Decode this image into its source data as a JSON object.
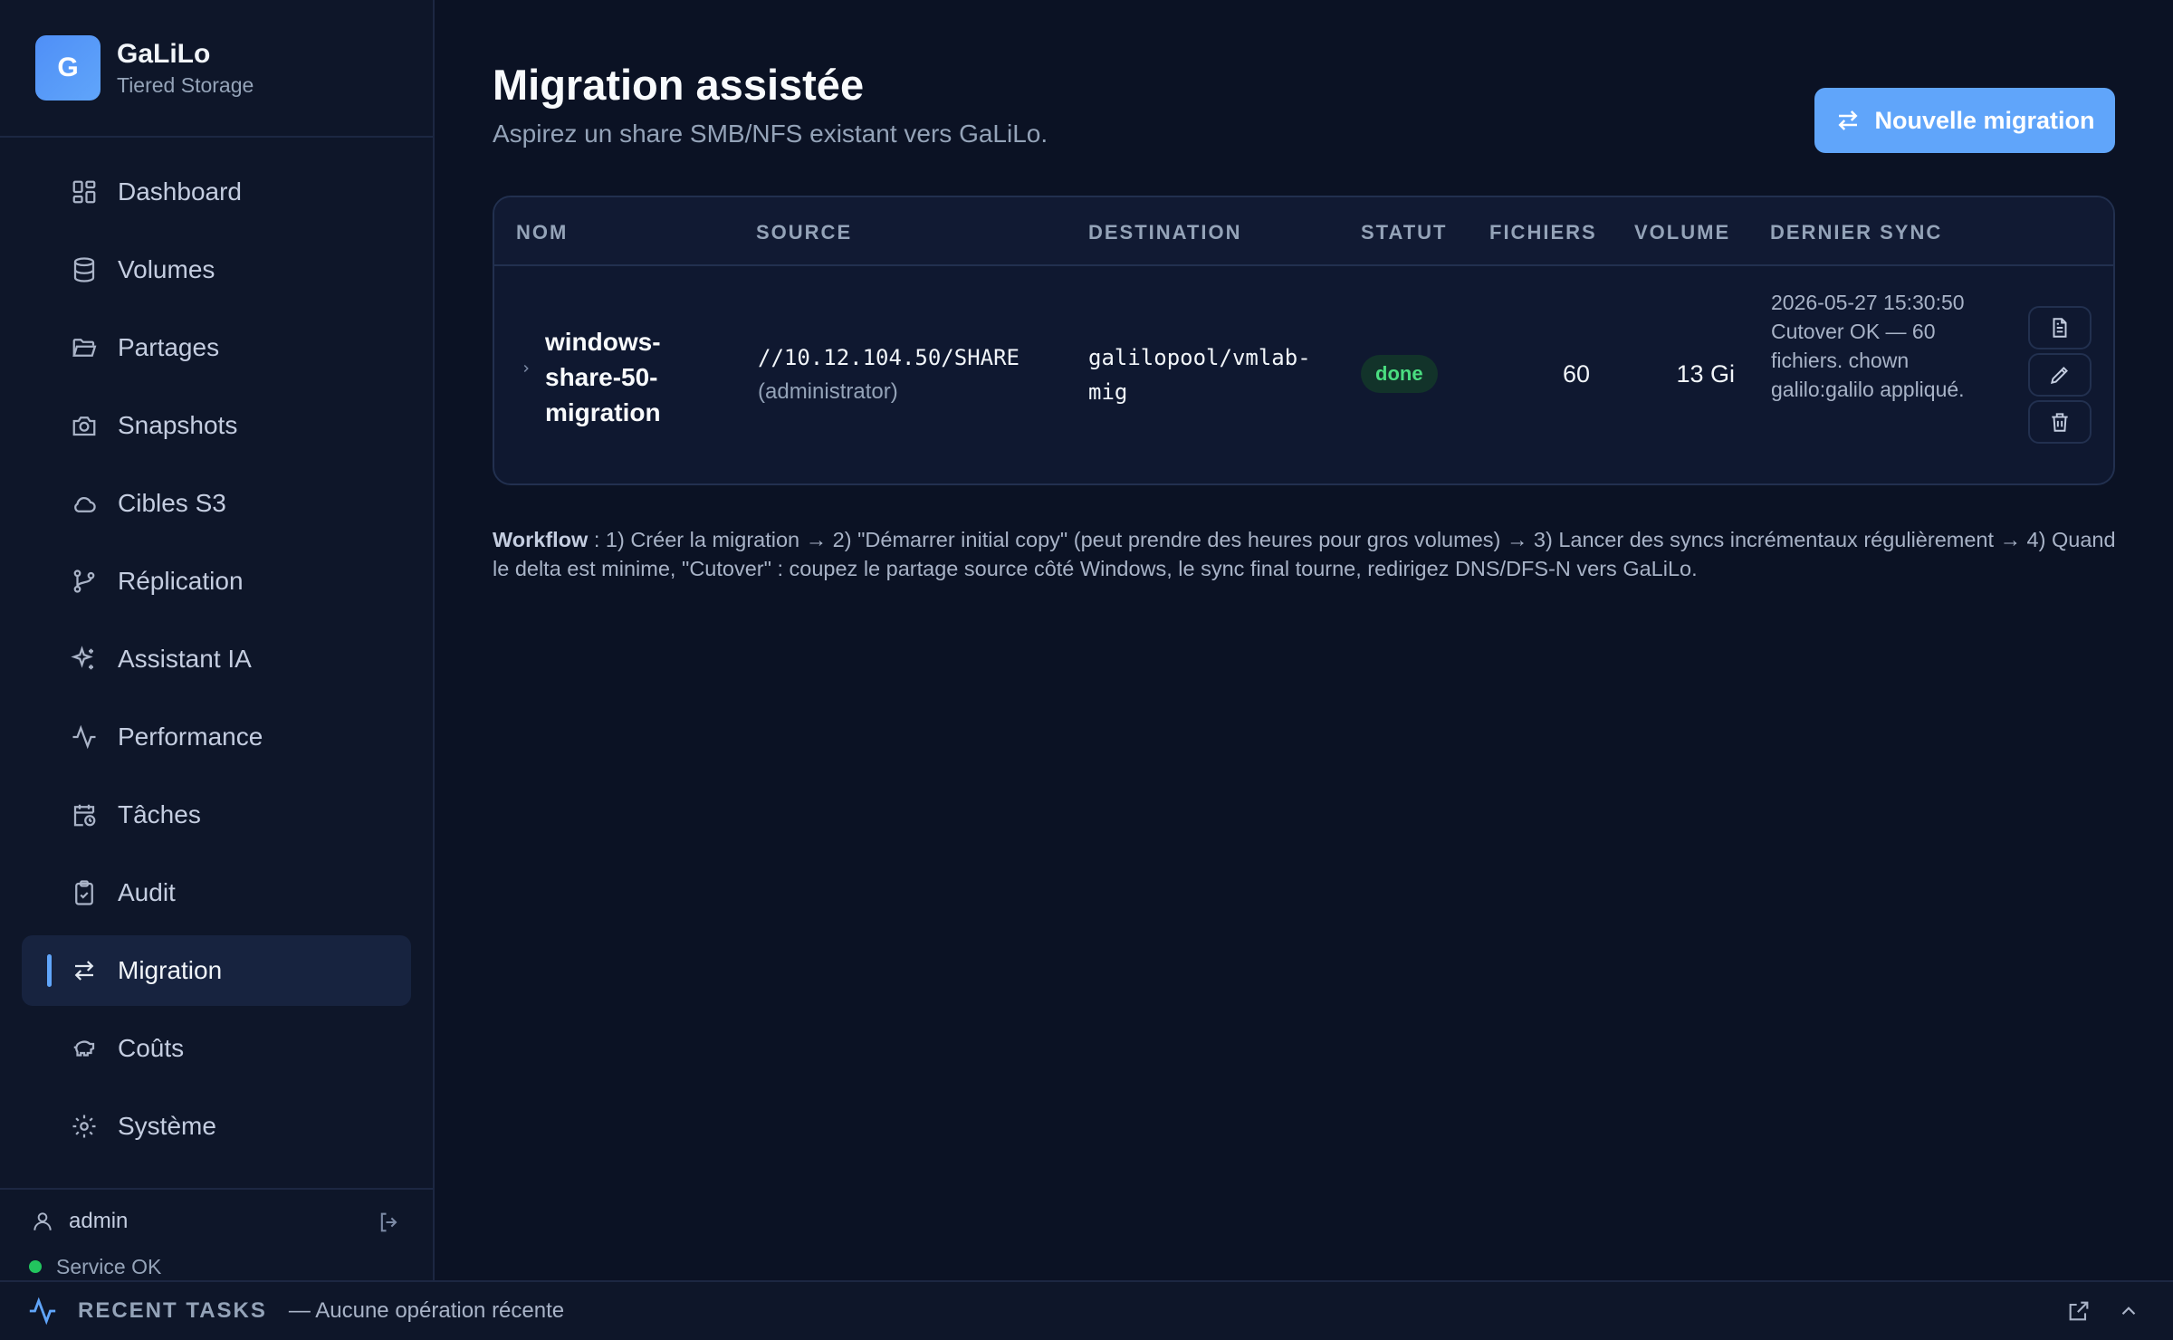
{
  "brand": {
    "logo_letter": "G",
    "name": "GaLiLo",
    "subtitle": "Tiered Storage"
  },
  "sidebar": {
    "items": [
      {
        "label": "Dashboard",
        "icon": "dashboard-icon"
      },
      {
        "label": "Volumes",
        "icon": "database-icon"
      },
      {
        "label": "Partages",
        "icon": "folder-icon"
      },
      {
        "label": "Snapshots",
        "icon": "camera-icon"
      },
      {
        "label": "Cibles S3",
        "icon": "cloud-icon"
      },
      {
        "label": "Réplication",
        "icon": "git-branch-icon"
      },
      {
        "label": "Assistant IA",
        "icon": "sparkles-icon"
      },
      {
        "label": "Performance",
        "icon": "activity-icon"
      },
      {
        "label": "Tâches",
        "icon": "calendar-clock-icon"
      },
      {
        "label": "Audit",
        "icon": "clipboard-check-icon"
      },
      {
        "label": "Migration",
        "icon": "arrows-swap-icon",
        "active": true
      },
      {
        "label": "Coûts",
        "icon": "piggy-bank-icon"
      },
      {
        "label": "Système",
        "icon": "gear-icon"
      }
    ],
    "footer": {
      "user": "admin",
      "service_status": "Service OK"
    }
  },
  "page": {
    "title": "Migration assistée",
    "subtitle": "Aspirez un share SMB/NFS existant vers GaLiLo.",
    "new_button": "Nouvelle migration"
  },
  "table": {
    "headers": [
      "NOM",
      "SOURCE",
      "DESTINATION",
      "STATUT",
      "FICHIERS",
      "VOLUME",
      "DERNIER SYNC"
    ],
    "rows": [
      {
        "name": "windows-share-50-migration",
        "source": "//10.12.104.50/SHARE",
        "source_user": "(administrator)",
        "destination": "galilopool/vmlab-mig",
        "status": "done",
        "files": "60",
        "volume": "13 Gi",
        "last_sync": "2026-05-27 15:30:50 Cutover OK — 60 fichiers. chown galilo:galilo appliqué."
      }
    ]
  },
  "workflow": {
    "label": "Workflow",
    "text": " : 1) Créer la migration → 2) \"Démarrer initial copy\" (peut prendre des heures pour gros volumes) → 3) Lancer des syncs incrémentaux régulièrement → 4) Quand le delta est minime, \"Cutover\" : coupez le partage source côté Windows, le sync final tourne, redirigez DNS/DFS-N vers GaLiLo."
  },
  "recent_tasks": {
    "label": "RECENT TASKS",
    "message": "— Aucune opération récente"
  },
  "colors": {
    "accent": "#60a5fa",
    "success": "#4ade80",
    "background": "#0b1224"
  }
}
